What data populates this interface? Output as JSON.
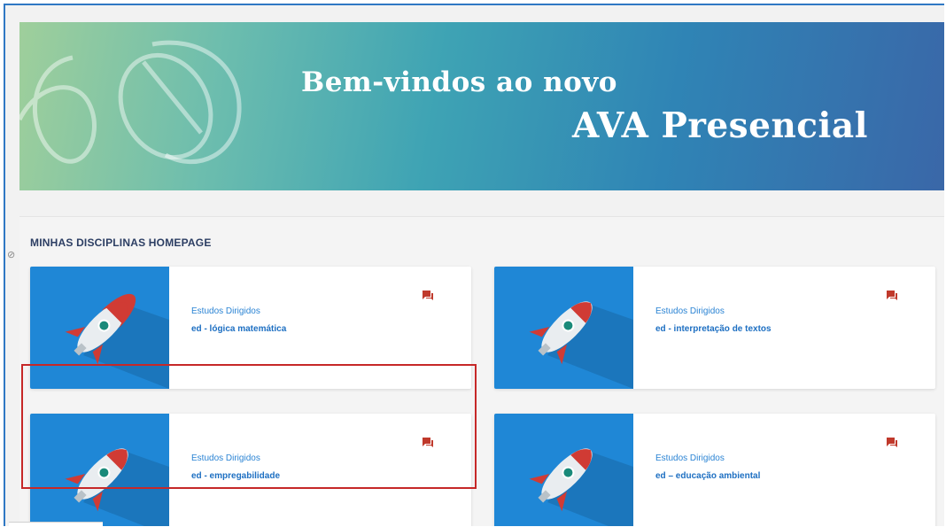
{
  "banner": {
    "line1": "Bem-vindos ao novo",
    "line2": "AVA Presencial"
  },
  "section": {
    "title": "MINHAS DISCIPLINAS HOMEPAGE"
  },
  "courses": [
    {
      "category": "Estudos Dirigidos",
      "name": "ed - lógica matemática"
    },
    {
      "category": "Estudos Dirigidos",
      "name": "ed - interpretação de textos"
    },
    {
      "category": "Estudos Dirigidos",
      "name": "ed - empregabilidade"
    },
    {
      "category": "Estudos Dirigidos",
      "name": "ed – educação ambiental"
    }
  ],
  "colors": {
    "accent": "#1f87d6",
    "chat_icon": "#c0392b",
    "highlight": "#c62828"
  },
  "icons": {
    "course_image": "rocket-icon",
    "course_action": "chat-icon"
  }
}
